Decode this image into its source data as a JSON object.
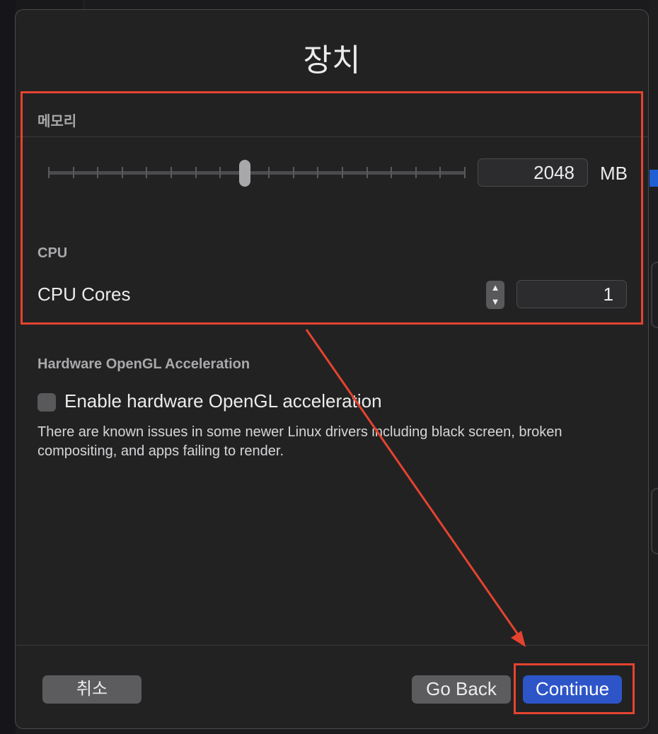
{
  "dialog": {
    "title": "장치",
    "memory": {
      "section_label": "메모리",
      "value": "2048",
      "unit": "MB",
      "slider_position": 0.472
    },
    "cpu": {
      "section_label": "CPU",
      "cores_label": "CPU Cores",
      "cores_value": "1"
    },
    "opengl": {
      "section_label": "Hardware OpenGL Acceleration",
      "checkbox_label": "Enable hardware OpenGL acceleration",
      "checked": false,
      "help_text": "There are known issues in some newer Linux drivers including black screen, broken compositing, and apps failing to render."
    },
    "buttons": {
      "cancel": "취소",
      "go_back": "Go Back",
      "continue": "Continue"
    }
  },
  "colors": {
    "annotation": "#e5432f",
    "primary_button": "#2d55c8",
    "dialog_background": "#222223"
  }
}
